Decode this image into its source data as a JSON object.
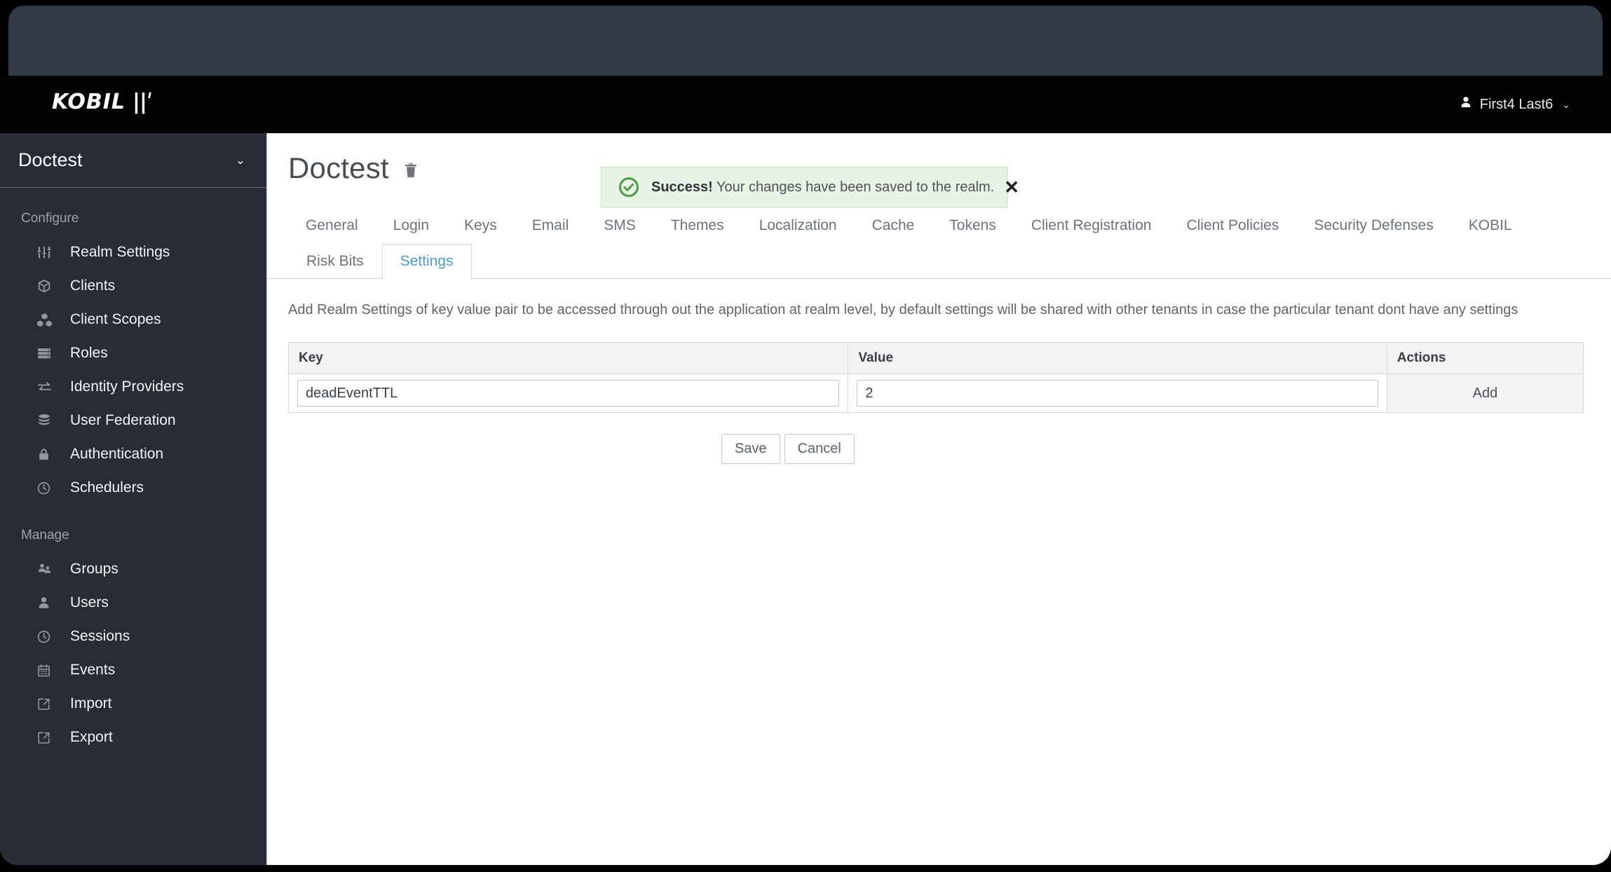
{
  "masthead": {
    "brand_text": "KOBIL",
    "brand_mark": "||ˈ",
    "user_name": "First4 Last6",
    "user_caret": "⌄",
    "user_icon": "person-icon"
  },
  "alert": {
    "icon": "check-circle-icon",
    "title": "Success!",
    "message": " Your changes have been saved to the realm.",
    "close_label": "✕",
    "accent_color": "#4a9e3f",
    "background_color": "#e7f4e5"
  },
  "sidebar": {
    "realm_name": "Doctest",
    "realm_caret": "⌄",
    "groups": [
      {
        "title": "Configure",
        "items": [
          {
            "label": "Realm Settings",
            "icon": "sliders-icon"
          },
          {
            "label": "Clients",
            "icon": "cube-icon"
          },
          {
            "label": "Client Scopes",
            "icon": "cubes-icon"
          },
          {
            "label": "Roles",
            "icon": "server-rows-icon"
          },
          {
            "label": "Identity Providers",
            "icon": "exchange-arrows-icon"
          },
          {
            "label": "User Federation",
            "icon": "database-icon"
          },
          {
            "label": "Authentication",
            "icon": "lock-icon"
          },
          {
            "label": "Schedulers",
            "icon": "clock-icon"
          }
        ]
      },
      {
        "title": "Manage",
        "items": [
          {
            "label": "Groups",
            "icon": "users-group-icon"
          },
          {
            "label": "Users",
            "icon": "user-icon"
          },
          {
            "label": "Sessions",
            "icon": "clock-icon"
          },
          {
            "label": "Events",
            "icon": "calendar-icon"
          },
          {
            "label": "Import",
            "icon": "import-arrow-icon"
          },
          {
            "label": "Export",
            "icon": "export-arrow-icon"
          }
        ]
      }
    ]
  },
  "main": {
    "page_title": "Doctest",
    "delete_icon": "trash-icon",
    "tabs_primary": [
      {
        "label": "General",
        "active": false
      },
      {
        "label": "Login",
        "active": false
      },
      {
        "label": "Keys",
        "active": false
      },
      {
        "label": "Email",
        "active": false
      },
      {
        "label": "SMS",
        "active": false
      },
      {
        "label": "Themes",
        "active": false
      },
      {
        "label": "Localization",
        "active": false
      },
      {
        "label": "Cache",
        "active": false
      },
      {
        "label": "Tokens",
        "active": false
      },
      {
        "label": "Client Registration",
        "active": false
      },
      {
        "label": "Client Policies",
        "active": false
      },
      {
        "label": "Security Defenses",
        "active": false
      },
      {
        "label": "KOBIL",
        "active": false
      }
    ],
    "tabs_secondary": [
      {
        "label": "Risk Bits",
        "active": false
      },
      {
        "label": "Settings",
        "active": true
      }
    ],
    "active_tab_color": "#4a9bd8",
    "description": "Add Realm Settings of key value pair to be accessed through out the application at realm level, by default settings will be shared with other tenants in case the particular tenant dont have any settings",
    "table": {
      "headers": [
        "Key",
        "Value",
        "Actions"
      ],
      "rows": [
        {
          "key_value": "deadEventTTL",
          "key_placeholder": "",
          "value_value": "2",
          "value_placeholder": "",
          "action_label": "Add"
        }
      ]
    },
    "buttons": {
      "save_label": "Save",
      "cancel_label": "Cancel"
    }
  }
}
